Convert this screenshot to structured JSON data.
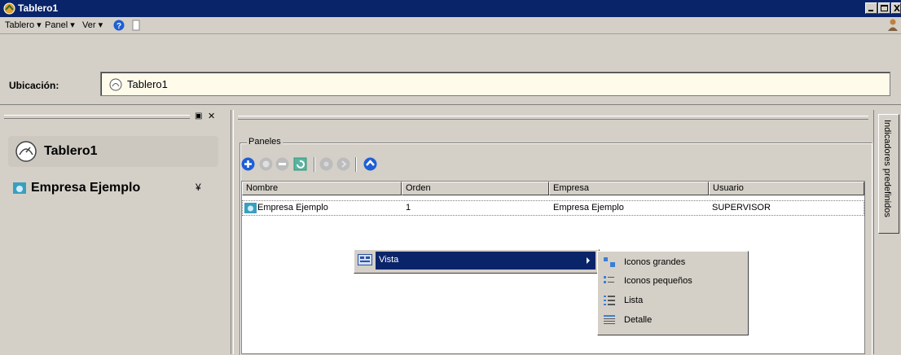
{
  "window": {
    "title": "Tablero1"
  },
  "menubar": {
    "items": [
      "Tablero",
      "Panel",
      "Ver"
    ]
  },
  "location": {
    "label": "Ubicación:",
    "value": "Tablero1"
  },
  "sidebar": {
    "items": [
      {
        "label": "Tablero1"
      },
      {
        "label": "Empresa Ejemplo"
      }
    ]
  },
  "panels": {
    "group_label": "Paneles",
    "columns": [
      "Nombre",
      "Orden",
      "Empresa",
      "Usuario"
    ],
    "rows": [
      {
        "nombre": "Empresa Ejemplo",
        "orden": "1",
        "empresa": "Empresa Ejemplo",
        "usuario": "SUPERVISOR"
      }
    ]
  },
  "context_menu": {
    "item": "Vista",
    "submenu": [
      "Iconos grandes",
      "Iconos pequeños",
      "Lista",
      "Detalle"
    ]
  },
  "right_tab": {
    "label": "Indicadores predefinidos"
  },
  "colors": {
    "titlebar": "#0a246a",
    "highlight": "#0a246a",
    "accent_blue": "#1f5fd6",
    "location_bg": "#fffbeb"
  }
}
